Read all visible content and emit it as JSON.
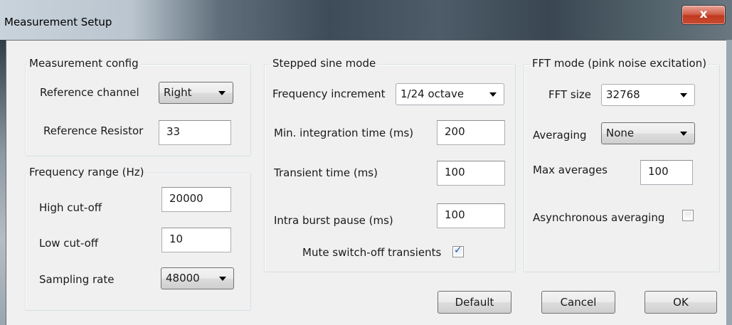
{
  "window": {
    "title": "Measurement Setup",
    "close_glyph": "x"
  },
  "measurement_config": {
    "legend": "Measurement config",
    "reference_channel": {
      "label": "Reference channel",
      "value": "Right"
    },
    "reference_resistor": {
      "label": "Reference Resistor",
      "value": "33"
    }
  },
  "frequency_range": {
    "legend": "Frequency range (Hz)",
    "high_cutoff": {
      "label": "High cut-off",
      "value": "20000"
    },
    "low_cutoff": {
      "label": "Low cut-off",
      "value": "10"
    },
    "sampling_rate": {
      "label": "Sampling rate",
      "value": "48000"
    }
  },
  "stepped_sine": {
    "legend": "Stepped sine mode",
    "frequency_increment": {
      "label": "Frequency increment",
      "value": "1/24 octave"
    },
    "min_integration_time": {
      "label": "Min. integration time (ms)",
      "value": "200"
    },
    "transient_time": {
      "label": "Transient time (ms)",
      "value": "100"
    },
    "intra_burst_pause": {
      "label": "Intra burst pause (ms)",
      "value": "100"
    },
    "mute_switch_off": {
      "label": "Mute switch-off transients",
      "checked": true
    }
  },
  "fft_mode": {
    "legend": "FFT mode (pink noise excitation)",
    "fft_size": {
      "label": "FFT size",
      "value": "32768"
    },
    "averaging": {
      "label": "Averaging",
      "value": "None"
    },
    "max_averages": {
      "label": "Max averages",
      "value": "100"
    },
    "asynchronous_averaging": {
      "label": "Asynchronous averaging",
      "checked": false
    }
  },
  "buttons": {
    "default": "Default",
    "cancel": "Cancel",
    "ok": "OK"
  }
}
